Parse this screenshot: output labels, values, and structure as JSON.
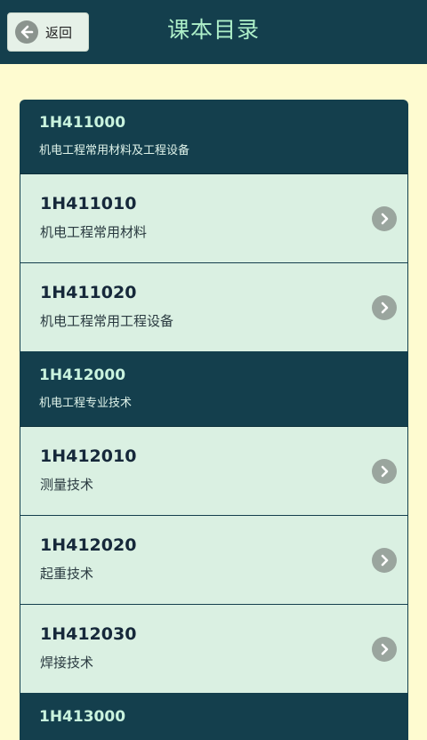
{
  "header": {
    "back_label": "返回",
    "title": "课本目录"
  },
  "rows": [
    {
      "type": "section",
      "code": "1H411000",
      "name": "机电工程常用材料及工程设备"
    },
    {
      "type": "item",
      "code": "1H411010",
      "name": "机电工程常用材料"
    },
    {
      "type": "item",
      "code": "1H411020",
      "name": "机电工程常用工程设备"
    },
    {
      "type": "section",
      "code": "1H412000",
      "name": "机电工程专业技术"
    },
    {
      "type": "item",
      "code": "1H412010",
      "name": "测量技术"
    },
    {
      "type": "item",
      "code": "1H412020",
      "name": "起重技术"
    },
    {
      "type": "item",
      "code": "1H412030",
      "name": "焊接技术"
    },
    {
      "type": "section",
      "code": "1H413000",
      "name": ""
    }
  ],
  "icons": {
    "back": "arrow-left-icon",
    "item": "chevron-right-icon"
  },
  "colors": {
    "header": "#143f4d",
    "page_bg": "#fefbd0",
    "item_bg": "#daf0e2",
    "title": "#aef0c9"
  }
}
